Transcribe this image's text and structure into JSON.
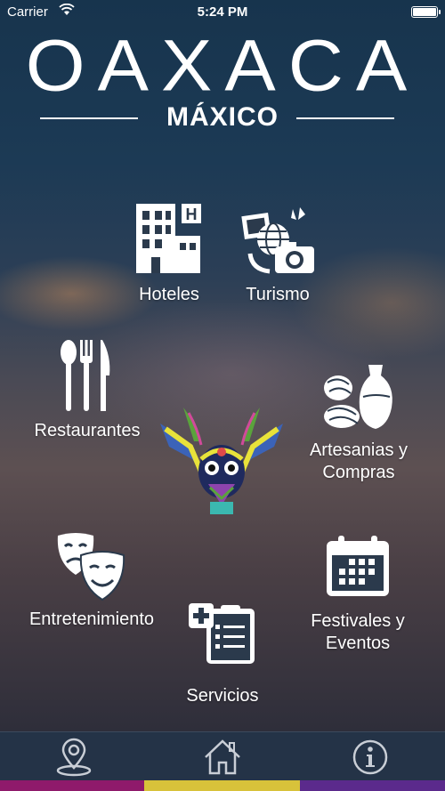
{
  "status_bar": {
    "carrier": "Carrier",
    "time": "5:24 PM"
  },
  "header": {
    "title": "OAXACA",
    "subtitle": "MÁXICO"
  },
  "menu": {
    "hoteles": "Hoteles",
    "turismo": "Turismo",
    "restaurantes": "Restaurantes",
    "artesanias_line1": "Artesanias y",
    "artesanias_line2": "Compras",
    "entretenimiento": "Entretenimiento",
    "festivales_line1": "Festivales y",
    "festivales_line2": "Eventos",
    "servicios": "Servicios"
  },
  "tabbar": {
    "icons": [
      "location-pin-icon",
      "home-icon",
      "info-icon"
    ],
    "stripe_colors": [
      "#8f1a6b",
      "#d8c23a",
      "#5b2a8c"
    ]
  }
}
